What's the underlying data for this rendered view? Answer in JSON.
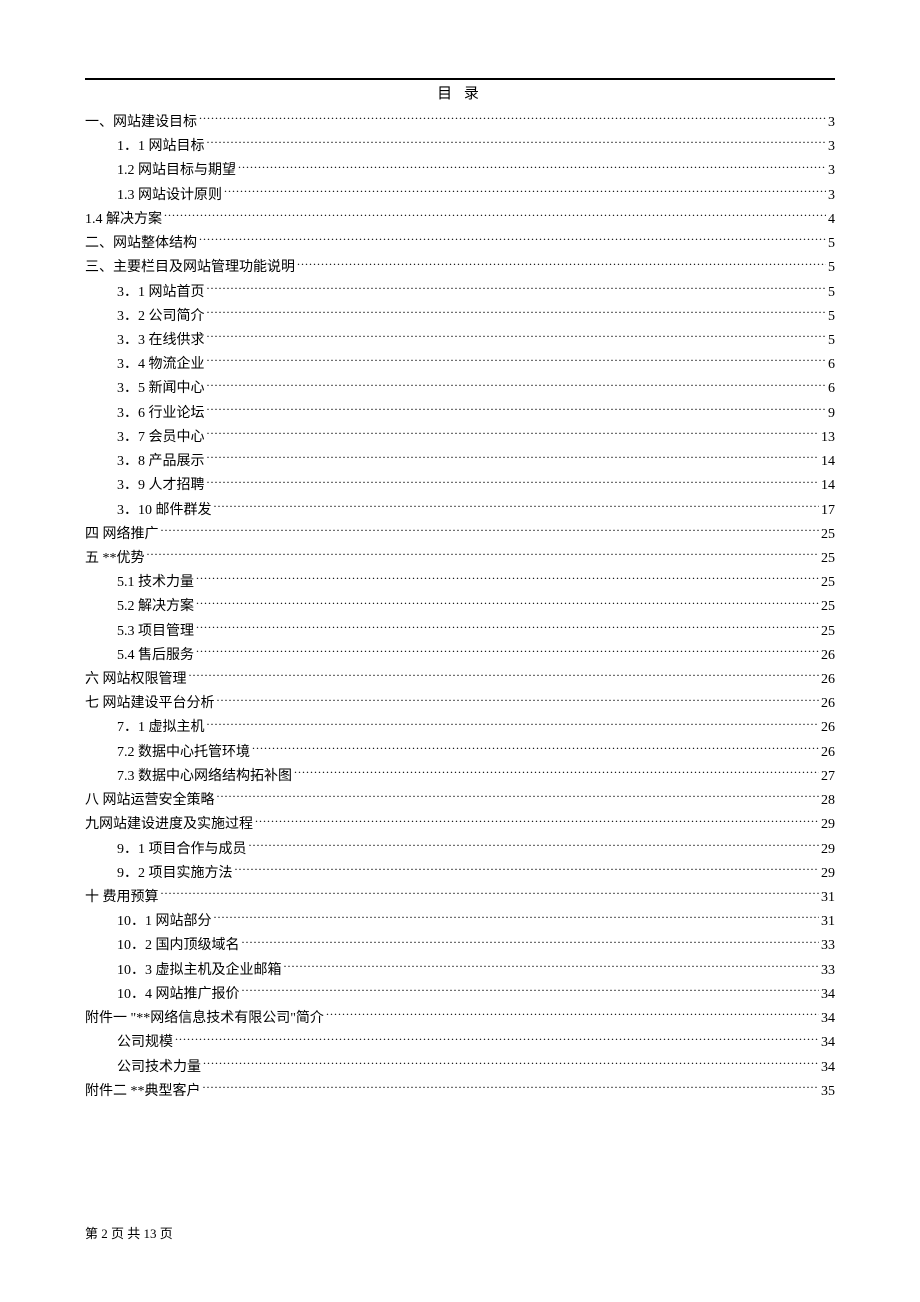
{
  "title": "目 录",
  "toc": [
    {
      "label": "一、网站建设目标",
      "page": "3",
      "indent": 0
    },
    {
      "label": "1．1 网站目标",
      "page": "3",
      "indent": 1
    },
    {
      "label": "1.2 网站目标与期望",
      "page": "3",
      "indent": 1
    },
    {
      "label": "1.3 网站设计原则",
      "page": "3",
      "indent": 1
    },
    {
      "label": "1.4 解决方案",
      "page": "4",
      "indent": 0
    },
    {
      "label": "二、网站整体结构",
      "page": "5",
      "indent": 0
    },
    {
      "label": "三、主要栏目及网站管理功能说明",
      "page": "5",
      "indent": 0
    },
    {
      "label": "3．1 网站首页",
      "page": "5",
      "indent": 1
    },
    {
      "label": "3．2 公司简介",
      "page": "5",
      "indent": 1
    },
    {
      "label": "3．3 在线供求",
      "page": "5",
      "indent": 1
    },
    {
      "label": "3．4 物流企业",
      "page": "6",
      "indent": 1
    },
    {
      "label": "3．5 新闻中心",
      "page": "6",
      "indent": 1
    },
    {
      "label": "3．6 行业论坛",
      "page": "9",
      "indent": 1
    },
    {
      "label": "3．7 会员中心",
      "page": "13",
      "indent": 1
    },
    {
      "label": "3．8 产品展示",
      "page": "14",
      "indent": 1
    },
    {
      "label": "3．9 人才招聘",
      "page": "14",
      "indent": 1
    },
    {
      "label": "3．10 邮件群发",
      "page": "17",
      "indent": 1
    },
    {
      "label": "四   网络推广",
      "page": "25",
      "indent": 0
    },
    {
      "label": "五 **优势",
      "page": "25",
      "indent": 0
    },
    {
      "label": "5.1 技术力量",
      "page": "25",
      "indent": 1
    },
    {
      "label": "5.2 解决方案",
      "page": "25",
      "indent": 1
    },
    {
      "label": "5.3 项目管理",
      "page": "25",
      "indent": 1
    },
    {
      "label": "5.4 售后服务",
      "page": "26",
      "indent": 1
    },
    {
      "label": "六 网站权限管理",
      "page": "26",
      "indent": 0
    },
    {
      "label": "七 网站建设平台分析",
      "page": "26",
      "indent": 0
    },
    {
      "label": "7．1 虚拟主机",
      "page": "26",
      "indent": 1
    },
    {
      "label": "7.2 数据中心托管环境",
      "page": "26",
      "indent": 1
    },
    {
      "label": "7.3 数据中心网络结构拓补图",
      "page": "27",
      "indent": 1
    },
    {
      "label": "八 网站运营安全策略",
      "page": "28",
      "indent": 0
    },
    {
      "label": "九网站建设进度及实施过程",
      "page": "29",
      "indent": 0
    },
    {
      "label": "9．1 项目合作与成员",
      "page": "29",
      "indent": 1
    },
    {
      "label": "9．2 项目实施方法",
      "page": "29",
      "indent": 1
    },
    {
      "label": "十 费用预算",
      "page": "31",
      "indent": 0
    },
    {
      "label": "10．1 网站部分",
      "page": "31",
      "indent": 1
    },
    {
      "label": "10．2 国内顶级域名",
      "page": "33",
      "indent": 1
    },
    {
      "label": "10．3 虚拟主机及企业邮箱",
      "page": "33",
      "indent": 1
    },
    {
      "label": "10．4 网站推广报价",
      "page": "34",
      "indent": 1
    },
    {
      "label": "附件一  \"**网络信息技术有限公司\"简介",
      "page": "34",
      "indent": 0
    },
    {
      "label": "公司规模",
      "page": "34",
      "indent": 1
    },
    {
      "label": "公司技术力量",
      "page": "34",
      "indent": 1
    },
    {
      "label": "附件二 **典型客户",
      "page": "35",
      "indent": 0
    }
  ],
  "footer": "第 2 页 共 13 页"
}
